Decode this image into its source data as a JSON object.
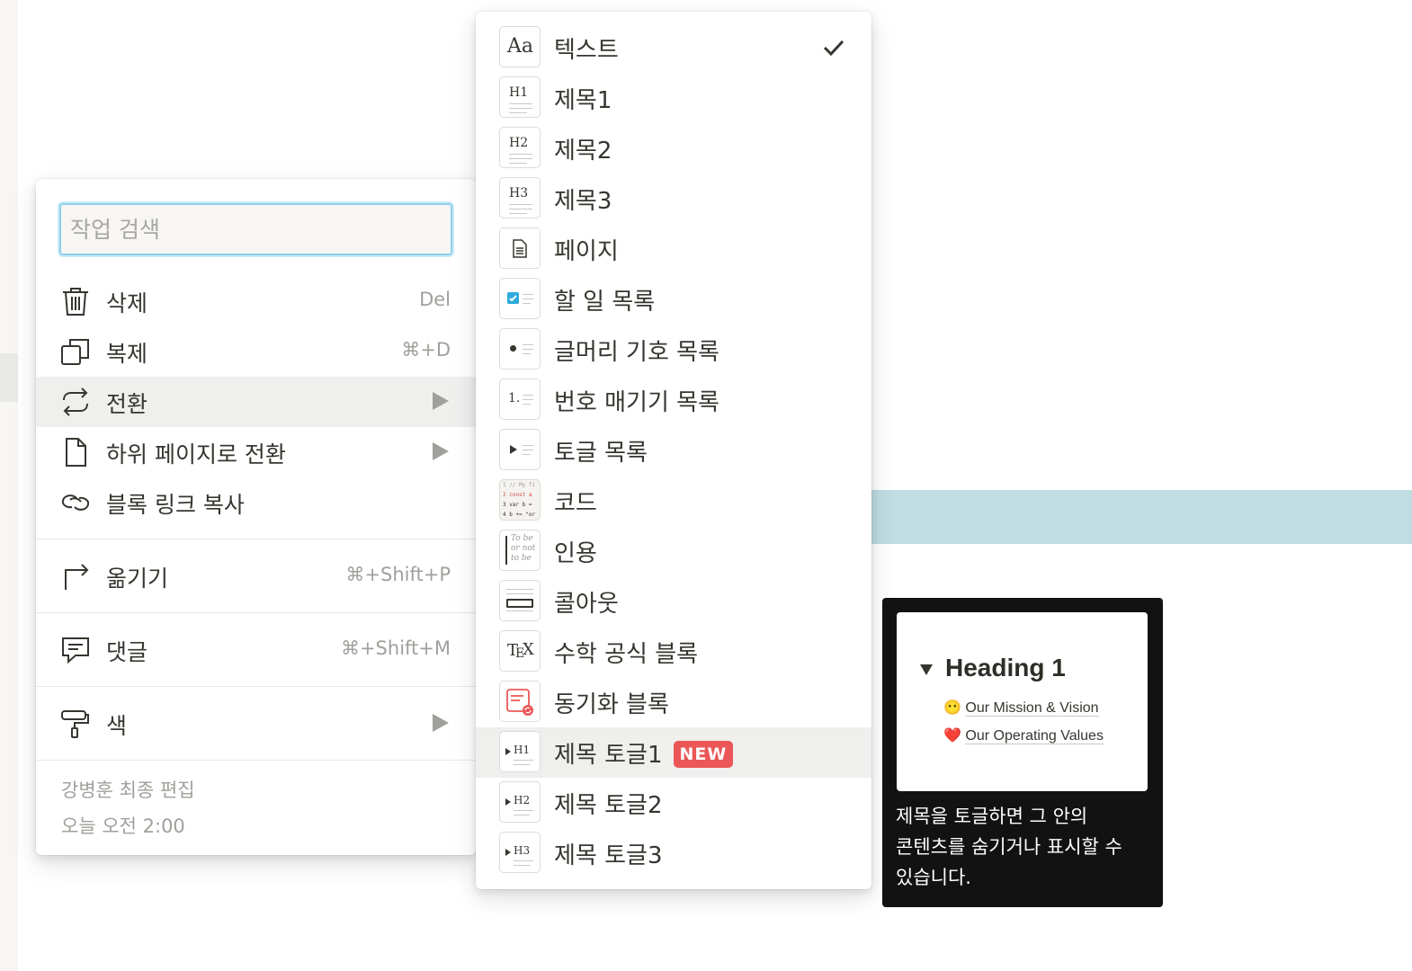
{
  "action_menu": {
    "search": {
      "placeholder": "작업 검색",
      "value": ""
    },
    "items": [
      {
        "icon": "trash-icon",
        "label": "삭제",
        "shortcut": "Del"
      },
      {
        "icon": "duplicate-icon",
        "label": "복제",
        "shortcut": "⌘+D"
      },
      {
        "icon": "turn-into-icon",
        "label": "전환",
        "has_submenu": true,
        "active": true
      },
      {
        "icon": "page-icon",
        "label": "하위 페이지로 전환",
        "has_submenu": true
      },
      {
        "icon": "link-icon",
        "label": "블록 링크 복사"
      },
      {
        "icon": "move-to-icon",
        "label": "옮기기",
        "shortcut": "⌘+Shift+P"
      },
      {
        "icon": "comment-icon",
        "label": "댓글",
        "shortcut": "⌘+Shift+M"
      },
      {
        "icon": "paint-roller-icon",
        "label": "색",
        "has_submenu": true
      }
    ],
    "last_edited": {
      "by": "강병훈 최종 편집",
      "time": "오늘 오전 2:00"
    }
  },
  "turn_into_menu": {
    "items": [
      {
        "thumb": "Aa",
        "label": "텍스트",
        "checked": true
      },
      {
        "thumb": "H1",
        "label": "제목1"
      },
      {
        "thumb": "H2",
        "label": "제목2"
      },
      {
        "thumb": "H3",
        "label": "제목3"
      },
      {
        "thumb": "page",
        "label": "페이지"
      },
      {
        "thumb": "todo",
        "label": "할 일 목록"
      },
      {
        "thumb": "bullet",
        "label": "글머리 기호 목록"
      },
      {
        "thumb": "1.",
        "label": "번호 매기기 목록"
      },
      {
        "thumb": "toggle",
        "label": "토글 목록"
      },
      {
        "thumb": "code",
        "label": "코드",
        "code_lines": [
          "1 // My fi",
          "2 const a",
          "3 var b =",
          "4 b += \"or"
        ]
      },
      {
        "thumb": "quote",
        "label": "인용",
        "quote_lines": [
          "To be",
          "or not",
          "to be"
        ]
      },
      {
        "thumb": "callout",
        "label": "콜아웃"
      },
      {
        "thumb": "TeX",
        "label": "수학 공식 블록",
        "tex": [
          "T",
          "E",
          "X"
        ]
      },
      {
        "thumb": "synced",
        "label": "동기화 블록"
      },
      {
        "thumb": "H1",
        "label": "제목 토글1",
        "badge": "NEW",
        "hovered": true
      },
      {
        "thumb": "H2",
        "label": "제목 토글2"
      },
      {
        "thumb": "H3",
        "label": "제목 토글3"
      }
    ]
  },
  "tooltip": {
    "preview": {
      "heading": "Heading 1",
      "rows": [
        {
          "emoji": "😶",
          "text": "Our Mission & Vision"
        },
        {
          "emoji": "❤️",
          "text": "Our Operating Values"
        }
      ]
    },
    "description": "제목을 토글하면 그 안의 콘텐츠를 숨기거나 표시할 수 있습니다."
  },
  "colors": {
    "accent_focus": "#8ed0ec",
    "hover_bg": "#efefee",
    "new_badge": "#eb5757",
    "callout_band": "#bfdde3",
    "todo_check": "#2eaadc"
  }
}
